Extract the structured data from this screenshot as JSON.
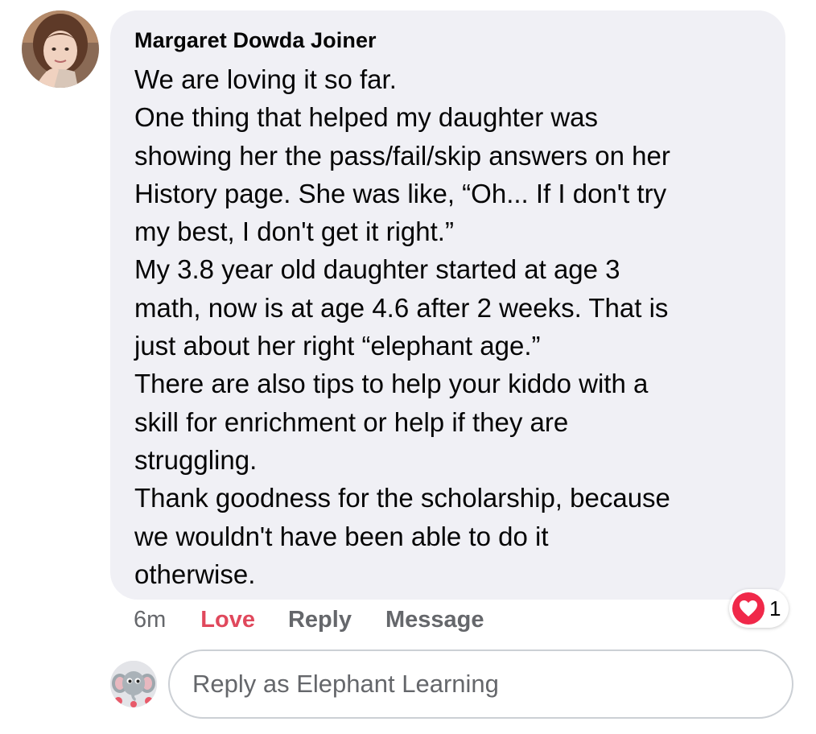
{
  "comment": {
    "author": "Margaret Dowda Joiner",
    "avatar_icon": "user-profile-photo",
    "lines": [
      "We are loving it so far.",
      "One thing that helped my daughter was",
      "showing her the pass/fail/skip answers on her",
      "History page. She was like, “Oh... If I don't try",
      "my best, I don't get it right.”",
      "My 3.8 year old daughter started at age 3",
      "math, now is at age 4.6 after 2 weeks. That is",
      "just about her right “elephant age.”",
      "There are also tips to help your kiddo with a",
      "skill for enrichment or help if they are",
      "struggling.",
      "Thank goodness for the scholarship, because",
      "we wouldn't have been able to do it",
      "otherwise."
    ],
    "time": "6m",
    "actions": {
      "love": "Love",
      "reply": "Reply",
      "message": "Message"
    },
    "reaction": {
      "icon": "heart-icon",
      "count": "1",
      "color": "#f02849"
    }
  },
  "reply_box": {
    "placeholder": "Reply as Elephant Learning",
    "avatar_icon": "elephant-icon"
  },
  "colors": {
    "bubble": "#f0f0f5",
    "love_active": "#e0485c",
    "secondary_text": "#65676b"
  }
}
